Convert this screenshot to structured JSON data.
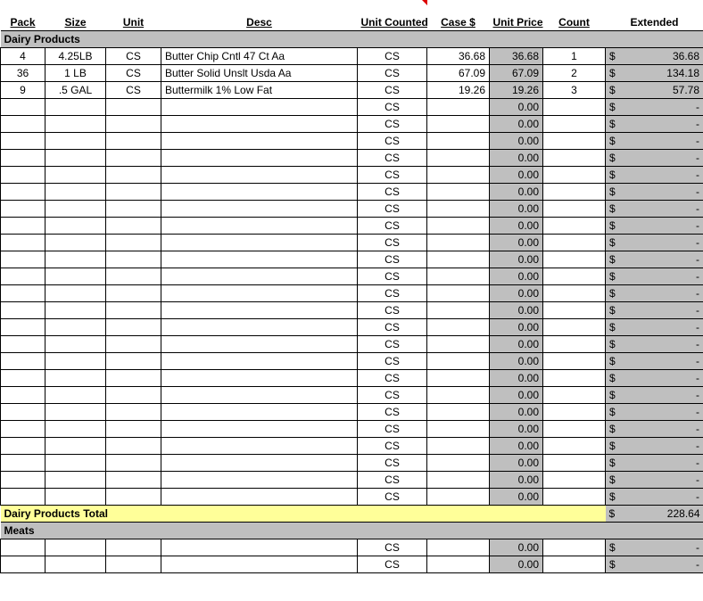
{
  "headers": {
    "pack": "Pack",
    "size": "Size",
    "unit": "Unit",
    "desc": "Desc",
    "unit_counted": "Unit Counted",
    "case": "Case $",
    "unit_price": "Unit Price",
    "count": "Count",
    "extended": "Extended"
  },
  "sections": [
    {
      "name": "Dairy Products",
      "total_label": "Dairy Products Total",
      "total_extended": "228.64",
      "rows": [
        {
          "pack": "4",
          "size": "4.25LB",
          "unit": "CS",
          "desc": "Butter Chip Cntl 47 Ct Aa",
          "unit_counted": "CS",
          "case": "36.68",
          "unit_price": "36.68",
          "count": "1",
          "ext": "36.68"
        },
        {
          "pack": "36",
          "size": "1 LB",
          "unit": "CS",
          "desc": "Butter Solid Unslt Usda Aa",
          "unit_counted": "CS",
          "case": "67.09",
          "unit_price": "67.09",
          "count": "2",
          "ext": "134.18"
        },
        {
          "pack": "9",
          "size": ".5 GAL",
          "unit": "CS",
          "desc": "Buttermilk 1% Low Fat",
          "unit_counted": "CS",
          "case": "19.26",
          "unit_price": "19.26",
          "count": "3",
          "ext": "57.78"
        },
        {
          "pack": "",
          "size": "",
          "unit": "",
          "desc": "",
          "unit_counted": "CS",
          "case": "",
          "unit_price": "0.00",
          "count": "",
          "ext": "-"
        },
        {
          "pack": "",
          "size": "",
          "unit": "",
          "desc": "",
          "unit_counted": "CS",
          "case": "",
          "unit_price": "0.00",
          "count": "",
          "ext": "-"
        },
        {
          "pack": "",
          "size": "",
          "unit": "",
          "desc": "",
          "unit_counted": "CS",
          "case": "",
          "unit_price": "0.00",
          "count": "",
          "ext": "-"
        },
        {
          "pack": "",
          "size": "",
          "unit": "",
          "desc": "",
          "unit_counted": "CS",
          "case": "",
          "unit_price": "0.00",
          "count": "",
          "ext": "-"
        },
        {
          "pack": "",
          "size": "",
          "unit": "",
          "desc": "",
          "unit_counted": "CS",
          "case": "",
          "unit_price": "0.00",
          "count": "",
          "ext": "-"
        },
        {
          "pack": "",
          "size": "",
          "unit": "",
          "desc": "",
          "unit_counted": "CS",
          "case": "",
          "unit_price": "0.00",
          "count": "",
          "ext": "-"
        },
        {
          "pack": "",
          "size": "",
          "unit": "",
          "desc": "",
          "unit_counted": "CS",
          "case": "",
          "unit_price": "0.00",
          "count": "",
          "ext": "-"
        },
        {
          "pack": "",
          "size": "",
          "unit": "",
          "desc": "",
          "unit_counted": "CS",
          "case": "",
          "unit_price": "0.00",
          "count": "",
          "ext": "-"
        },
        {
          "pack": "",
          "size": "",
          "unit": "",
          "desc": "",
          "unit_counted": "CS",
          "case": "",
          "unit_price": "0.00",
          "count": "",
          "ext": "-"
        },
        {
          "pack": "",
          "size": "",
          "unit": "",
          "desc": "",
          "unit_counted": "CS",
          "case": "",
          "unit_price": "0.00",
          "count": "",
          "ext": "-"
        },
        {
          "pack": "",
          "size": "",
          "unit": "",
          "desc": "",
          "unit_counted": "CS",
          "case": "",
          "unit_price": "0.00",
          "count": "",
          "ext": "-"
        },
        {
          "pack": "",
          "size": "",
          "unit": "",
          "desc": "",
          "unit_counted": "CS",
          "case": "",
          "unit_price": "0.00",
          "count": "",
          "ext": "-"
        },
        {
          "pack": "",
          "size": "",
          "unit": "",
          "desc": "",
          "unit_counted": "CS",
          "case": "",
          "unit_price": "0.00",
          "count": "",
          "ext": "-"
        },
        {
          "pack": "",
          "size": "",
          "unit": "",
          "desc": "",
          "unit_counted": "CS",
          "case": "",
          "unit_price": "0.00",
          "count": "",
          "ext": "-"
        },
        {
          "pack": "",
          "size": "",
          "unit": "",
          "desc": "",
          "unit_counted": "CS",
          "case": "",
          "unit_price": "0.00",
          "count": "",
          "ext": "-"
        },
        {
          "pack": "",
          "size": "",
          "unit": "",
          "desc": "",
          "unit_counted": "CS",
          "case": "",
          "unit_price": "0.00",
          "count": "",
          "ext": "-"
        },
        {
          "pack": "",
          "size": "",
          "unit": "",
          "desc": "",
          "unit_counted": "CS",
          "case": "",
          "unit_price": "0.00",
          "count": "",
          "ext": "-"
        },
        {
          "pack": "",
          "size": "",
          "unit": "",
          "desc": "",
          "unit_counted": "CS",
          "case": "",
          "unit_price": "0.00",
          "count": "",
          "ext": "-"
        },
        {
          "pack": "",
          "size": "",
          "unit": "",
          "desc": "",
          "unit_counted": "CS",
          "case": "",
          "unit_price": "0.00",
          "count": "",
          "ext": "-"
        },
        {
          "pack": "",
          "size": "",
          "unit": "",
          "desc": "",
          "unit_counted": "CS",
          "case": "",
          "unit_price": "0.00",
          "count": "",
          "ext": "-"
        },
        {
          "pack": "",
          "size": "",
          "unit": "",
          "desc": "",
          "unit_counted": "CS",
          "case": "",
          "unit_price": "0.00",
          "count": "",
          "ext": "-"
        },
        {
          "pack": "",
          "size": "",
          "unit": "",
          "desc": "",
          "unit_counted": "CS",
          "case": "",
          "unit_price": "0.00",
          "count": "",
          "ext": "-"
        },
        {
          "pack": "",
          "size": "",
          "unit": "",
          "desc": "",
          "unit_counted": "CS",
          "case": "",
          "unit_price": "0.00",
          "count": "",
          "ext": "-"
        },
        {
          "pack": "",
          "size": "",
          "unit": "",
          "desc": "",
          "unit_counted": "CS",
          "case": "",
          "unit_price": "0.00",
          "count": "",
          "ext": "-"
        }
      ]
    },
    {
      "name": "Meats",
      "rows": [
        {
          "pack": "",
          "size": "",
          "unit": "",
          "desc": "",
          "unit_counted": "CS",
          "case": "",
          "unit_price": "0.00",
          "count": "",
          "ext": "-"
        },
        {
          "pack": "",
          "size": "",
          "unit": "",
          "desc": "",
          "unit_counted": "CS",
          "case": "",
          "unit_price": "0.00",
          "count": "",
          "ext": "-"
        }
      ]
    }
  ],
  "currency_symbol": "$"
}
